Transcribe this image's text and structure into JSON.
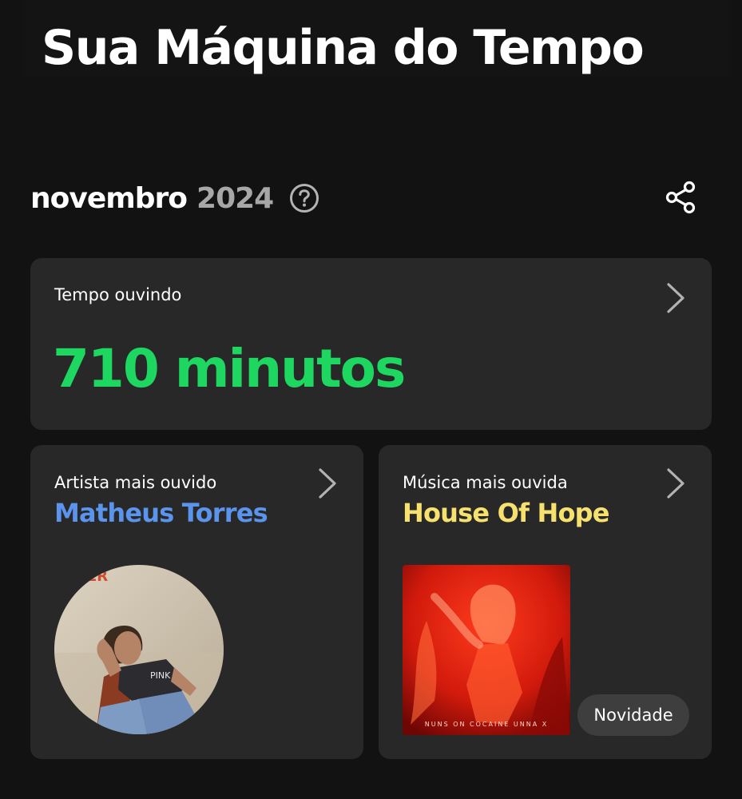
{
  "header": {
    "title": "Sua Máquina do Tempo"
  },
  "period": {
    "month": "novembro",
    "year": "2024",
    "help_icon": "question-circle-icon",
    "share_icon": "share-icon"
  },
  "listening_time": {
    "label": "Tempo ouvindo",
    "value": "710 minutos",
    "accent_color": "#1ed760"
  },
  "top_artist": {
    "label": "Artista mais ouvido",
    "name": "Matheus Torres",
    "accent_color": "#5a94ec",
    "image": "artist-photo"
  },
  "top_song": {
    "label": "Música mais ouvida",
    "title": "House Of Hope",
    "accent_color": "#f6e16f",
    "cover_text": "NUNS ON COCAINE  UNNA X",
    "badge": "Novidade"
  },
  "theme": {
    "background": "#121212",
    "card": "#282828"
  }
}
